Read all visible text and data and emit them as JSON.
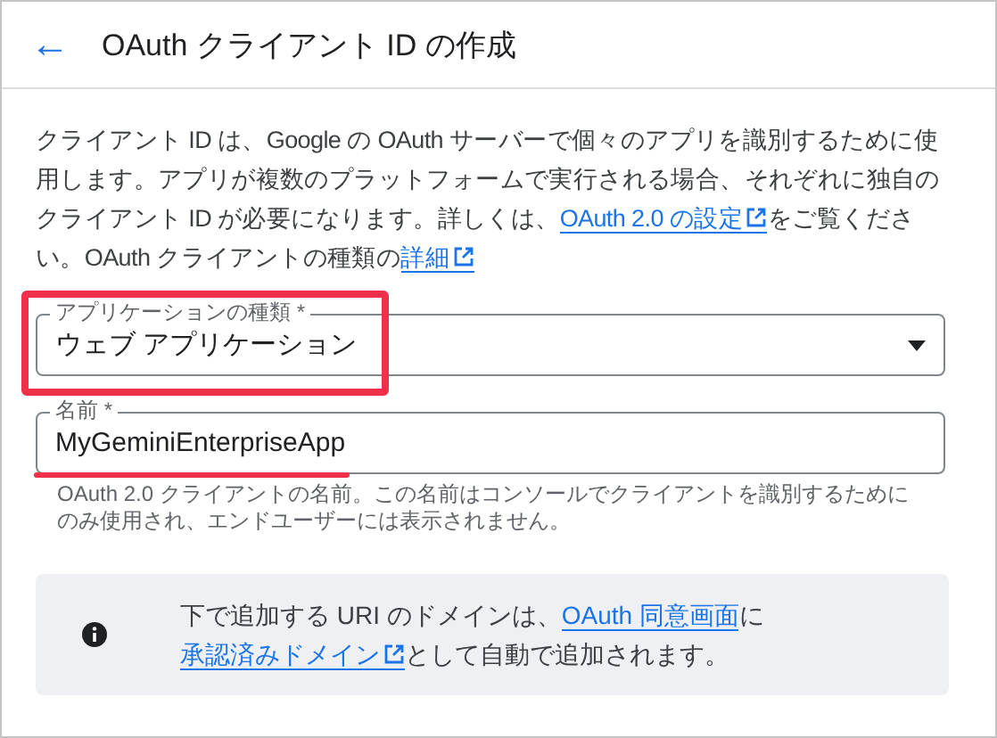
{
  "header": {
    "back": "←",
    "title": "OAuth クライアント ID の作成"
  },
  "description": [
    {
      "kind": "text",
      "text": "クライアント ID は、Google の OAuth サーバーで個々のアプリを識別するために使用します。アプリが複数のプラットフォームで実行される場合、それぞれに独自のクライアント ID が必要になります。詳しくは、"
    },
    {
      "kind": "link",
      "text": "OAuth 2.0 の設定",
      "external": true
    },
    {
      "kind": "text",
      "text": "をご覧ください。OAuth クライアントの種類の"
    },
    {
      "kind": "link",
      "text": "詳細",
      "external": true
    }
  ],
  "app_type": {
    "label": "アプリケーションの種類 *",
    "value": "ウェブ アプリケーション"
  },
  "name": {
    "label": "名前 *",
    "value": "MyGeminiEnterpriseApp",
    "helper": "OAuth 2.0 クライアントの名前。この名前はコンソールでクライアントを識別するためにのみ使用され、エンドユーザーには表示されません。"
  },
  "info": [
    {
      "kind": "text",
      "text": "下で追加する URI のドメインは、"
    },
    {
      "kind": "link",
      "text": "OAuth 同意画面",
      "external": false
    },
    {
      "kind": "text",
      "text": "に"
    },
    {
      "kind": "link",
      "text": "承認済みドメイン",
      "external": true
    },
    {
      "kind": "text",
      "text": "として自動で追加されます。"
    }
  ]
}
